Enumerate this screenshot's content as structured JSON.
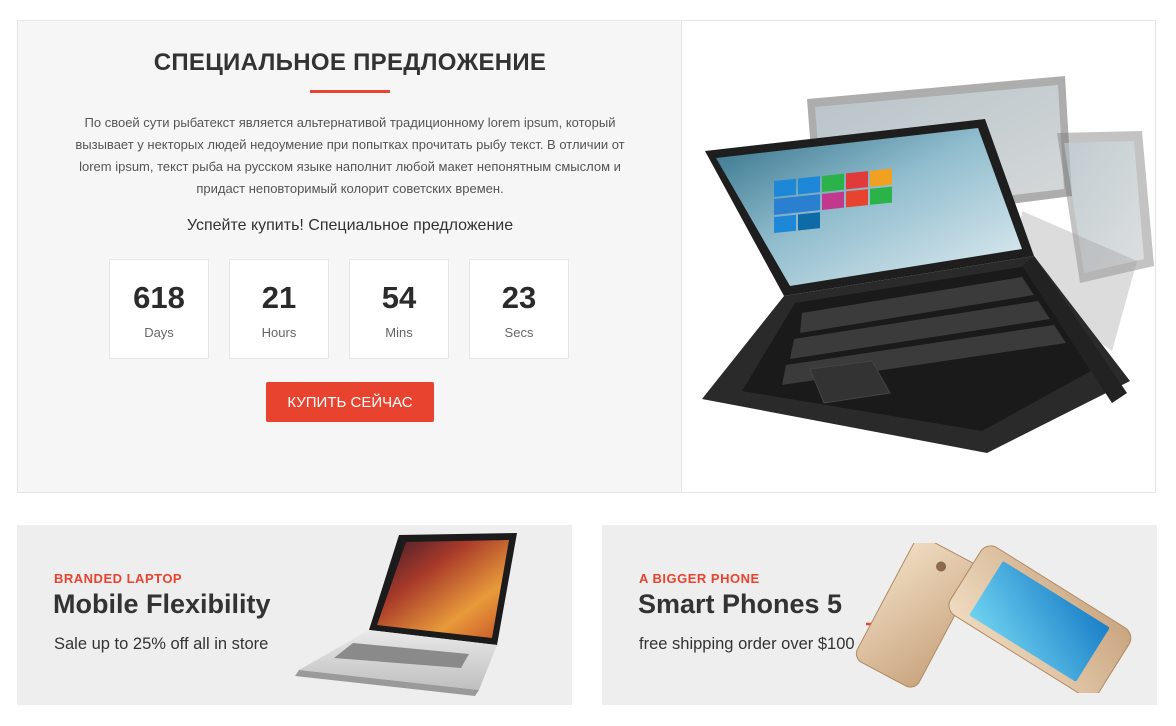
{
  "deal": {
    "title": "СПЕЦИАЛЬНОЕ ПРЕДЛОЖЕНИЕ",
    "description": "По своей сути рыбатекст является альтернативой традиционному lorem ipsum, который вызывает у некторых людей недоумение при попытках прочитать рыбу текст. В отличии от lorem ipsum, текст рыба на русском языке наполнит любой макет непонятным смыслом и придаст неповторимый колорит советских времен.",
    "subtitle": "Успейте купить! Специальное предложение",
    "countdown": [
      {
        "value": "618",
        "label": "Days"
      },
      {
        "value": "21",
        "label": "Hours"
      },
      {
        "value": "54",
        "label": "Mins"
      },
      {
        "value": "23",
        "label": "Secs"
      }
    ],
    "button_label": "КУПИТЬ СЕЙЧАС",
    "image_icon": "convertible-laptop-image"
  },
  "banners": [
    {
      "eyebrow": "BRANDED LAPTOP",
      "title": "Mobile Flexibility",
      "subtitle": "Sale up to 25% off all in store",
      "image_icon": "laptop-image"
    },
    {
      "eyebrow": "A BIGGER PHONE",
      "title": "Smart  Phones 5",
      "subtitle": "free shipping order over $100",
      "image_icon": "smartphones-image",
      "cart_icon": "shopping-cart-icon"
    }
  ],
  "colors": {
    "accent": "#e8432f",
    "panel_bg": "#f6f6f6",
    "banner_bg": "#eeeeee",
    "text_dark": "#333333"
  }
}
